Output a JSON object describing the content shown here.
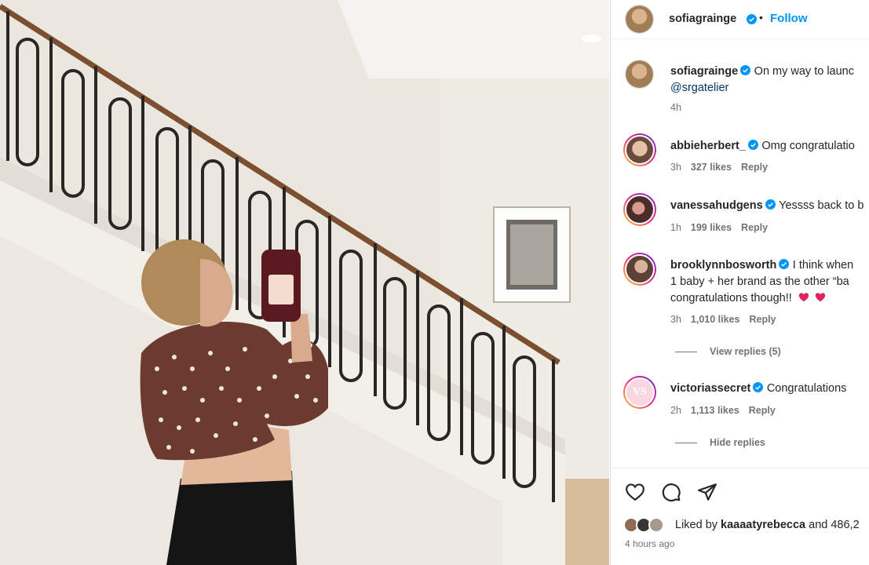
{
  "post_author": {
    "username": "sofiagrainge",
    "separator": "•",
    "follow_label": "Follow"
  },
  "caption": {
    "username": "sofiagrainge",
    "text": "On my way to launc",
    "mention": "@srgatelier",
    "time": "4h"
  },
  "comments": [
    {
      "username": "abbieherbert_",
      "text": "Omg congratulatio",
      "time": "3h",
      "likes": "327 likes",
      "reply": "Reply",
      "avatar_color": "#8a6a5a"
    },
    {
      "username": "vanessahudgens",
      "text": "Yessss back to b",
      "time": "1h",
      "likes": "199 likes",
      "reply": "Reply",
      "avatar_color": "#5a3a38"
    },
    {
      "username": "brooklynnbosworth",
      "text_line1": "I think when",
      "text_line2": "1 baby + her brand as the other “ba",
      "text_line3": "congratulations though!!",
      "time": "3h",
      "likes": "1,010 likes",
      "reply": "Reply",
      "avatar_color": "#6b4e46"
    },
    {
      "username": "victoriassecret",
      "text": "Congratulations",
      "time": "2h",
      "likes": "1,113 likes",
      "reply": "Reply",
      "avatar_color": "#f3c6d6"
    }
  ],
  "threads": {
    "view_replies": "View replies (5)",
    "hide_replies": "Hide replies"
  },
  "footer": {
    "liked_prefix": "Liked by",
    "liked_user": "kaaaatyrebecca",
    "liked_suffix": "and 486,2",
    "posted_ago": "4 hours ago"
  },
  "icons": {
    "like": "heart-outline-icon",
    "comment": "comment-bubble-icon",
    "share": "paper-plane-icon",
    "verified": "verified-badge-icon"
  },
  "colors": {
    "accent_blue": "#0095f6",
    "verified_blue": "#0095f6",
    "heart_red": "#e0245e",
    "muted": "#737373"
  }
}
